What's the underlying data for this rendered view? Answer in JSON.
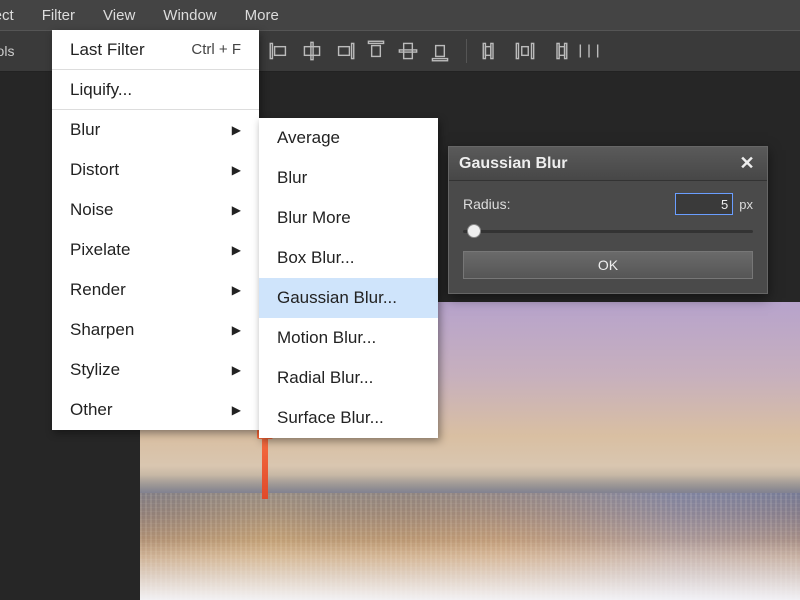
{
  "menubar": {
    "items": [
      "elect",
      "Filter",
      "View",
      "Window",
      "More"
    ]
  },
  "toolbar": {
    "label": "trols"
  },
  "filter_menu": {
    "last_filter": "Last Filter",
    "last_filter_shortcut": "Ctrl + F",
    "items": [
      {
        "label": "Liquify..."
      },
      {
        "label": "Blur",
        "submenu": true
      },
      {
        "label": "Distort",
        "submenu": true
      },
      {
        "label": "Noise",
        "submenu": true
      },
      {
        "label": "Pixelate",
        "submenu": true
      },
      {
        "label": "Render",
        "submenu": true
      },
      {
        "label": "Sharpen",
        "submenu": true
      },
      {
        "label": "Stylize",
        "submenu": true
      },
      {
        "label": "Other",
        "submenu": true
      }
    ]
  },
  "blur_submenu": {
    "items": [
      "Average",
      "Blur",
      "Blur More",
      "Box Blur...",
      "Gaussian Blur...",
      "Motion Blur...",
      "Radial Blur...",
      "Surface Blur..."
    ],
    "selected_index": 4
  },
  "dialog": {
    "title": "Gaussian Blur",
    "radius_label": "Radius:",
    "radius_value": "5",
    "radius_unit": "px",
    "ok_label": "OK"
  }
}
